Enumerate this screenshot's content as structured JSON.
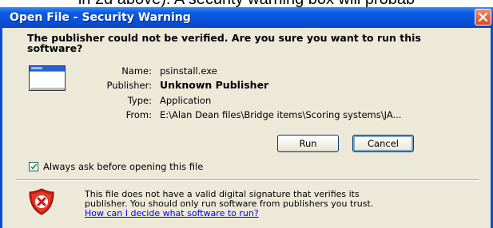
{
  "background_text": "in 2d above). A security warning box will probab",
  "window": {
    "title": "Open File - Security Warning"
  },
  "question": "The publisher could not be verified.  Are you sure you want to run this software?",
  "info": {
    "name_label": "Name:",
    "name_value": "psinstall.exe",
    "publisher_label": "Publisher:",
    "publisher_value": "Unknown Publisher",
    "type_label": "Type:",
    "type_value": "Application",
    "from_label": "From:",
    "from_value": "E:\\Alan Dean files\\Bridge items\\Scoring systems\\JA..."
  },
  "buttons": {
    "run": "Run",
    "cancel": "Cancel"
  },
  "checkbox": {
    "label": "Always ask before opening this file",
    "checked": true
  },
  "warning": {
    "line1": "This file does not have a valid digital signature that verifies its",
    "line2": "publisher.  You should only run software from publishers you trust.",
    "link": "How can I decide what software to run?"
  },
  "colors": {
    "titlebar": "#0a52d8",
    "window_bg": "#ece9d8",
    "close_button": "#d94a25",
    "link": "#0000ff"
  },
  "icons": {
    "program": "program-window-icon",
    "shield": "security-shield-icon",
    "close": "close-icon",
    "check": "checkmark-icon"
  }
}
